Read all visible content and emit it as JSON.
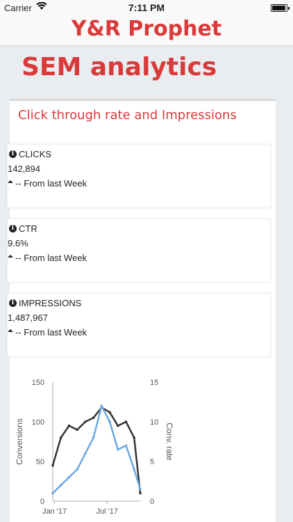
{
  "status_bar": {
    "carrier": "Carrier",
    "time": "7:11 PM"
  },
  "header": {
    "title": "Y&R Prophet"
  },
  "page": {
    "title": "SEM analytics"
  },
  "card": {
    "title": "Click through rate and Impressions"
  },
  "metrics": [
    {
      "label": "CLICKS",
      "value": "142,894",
      "change": "-- From last Week"
    },
    {
      "label": "CTR",
      "value": "9.6%",
      "change": "-- From last Week"
    },
    {
      "label": "IMPRESSIONS",
      "value": "1,487,967",
      "change": "-- From last Week"
    }
  ],
  "chart_data": {
    "type": "line",
    "xlabel": "",
    "ylabel": "Conversions",
    "y2label": "Conv. rate",
    "ylim": [
      0,
      150
    ],
    "y2lim": [
      0,
      15
    ],
    "yticks": [
      0,
      50,
      100,
      150
    ],
    "y2ticks": [
      0,
      5,
      10,
      15
    ],
    "x_ticks": [
      "Jan '17",
      "Jul '17"
    ],
    "x": [
      "2016-12-26",
      "2017-01-23",
      "2017-02-20",
      "2017-03-20",
      "2017-04-17",
      "2017-05-15",
      "2017-06-12",
      "2017-07-10",
      "2017-08-07",
      "2017-09-04",
      "2017-10-02",
      "2017-10-23"
    ],
    "series": [
      {
        "name": "Conversions",
        "axis": "left",
        "color": "#333333",
        "values": [
          45,
          80,
          95,
          90,
          100,
          105,
          118,
          112,
          95,
          100,
          80,
          10
        ]
      },
      {
        "name": "Conv. rate",
        "axis": "right",
        "color": "#6aa9e3",
        "values": [
          1.0,
          2.0,
          3.0,
          4.0,
          6.0,
          8.0,
          12.0,
          10.0,
          6.5,
          7.0,
          4.0,
          1.5
        ]
      }
    ],
    "colors": {
      "accent": "#d93a3a",
      "series_dark": "#333333",
      "series_blue": "#6aa9e3"
    }
  }
}
